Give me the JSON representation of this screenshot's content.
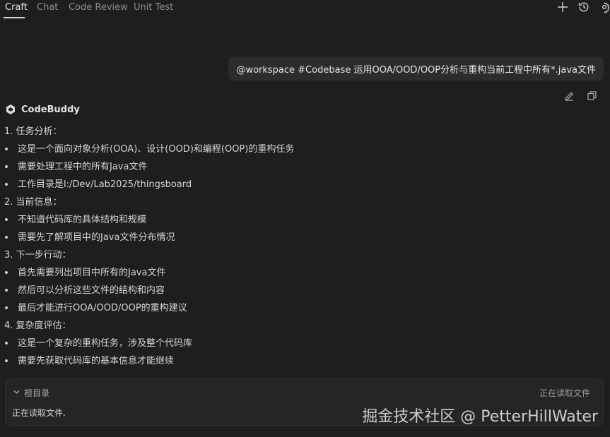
{
  "tabs": [
    {
      "label": "Craft",
      "active": true
    },
    {
      "label": "Chat",
      "active": false
    },
    {
      "label": "Code Review",
      "active": false
    },
    {
      "label": "Unit Test",
      "active": false
    }
  ],
  "toolbar_icons": [
    "plus-icon",
    "history-icon",
    "settings-icon"
  ],
  "user_message": "@workspace #Codebase 运用OOA/OOD/OOP分析与重构当前工程中所有*.java文件",
  "message_actions": [
    "edit-icon",
    "copy-icon"
  ],
  "assistant": {
    "name": "CodeBuddy",
    "lines": [
      {
        "type": "heading",
        "text": "1. 任务分析："
      },
      {
        "type": "bullet",
        "text": "这是一个面向对象分析(OOA)、设计(OOD)和编程(OOP)的重构任务"
      },
      {
        "type": "bullet",
        "text": "需要处理工程中的所有Java文件"
      },
      {
        "type": "bullet",
        "text": "工作目录是l:/Dev/Lab2025/thingsboard"
      },
      {
        "type": "heading",
        "text": "2. 当前信息："
      },
      {
        "type": "bullet",
        "text": "不知道代码库的具体结构和规模"
      },
      {
        "type": "bullet",
        "text": "需要先了解项目中的Java文件分布情况"
      },
      {
        "type": "heading",
        "text": "3. 下一步行动："
      },
      {
        "type": "bullet",
        "text": "首先需要列出项目中所有的Java文件"
      },
      {
        "type": "bullet",
        "text": "然后可以分析这些文件的结构和内容"
      },
      {
        "type": "bullet",
        "text": "最后才能进行OOA/OOD/OOP的重构建议"
      },
      {
        "type": "heading",
        "text": "4. 复杂度评估："
      },
      {
        "type": "bullet",
        "text": "这是一个复杂的重构任务，涉及整个代码库"
      },
      {
        "type": "bullet",
        "text": "需要先获取代码库的基本信息才能继续"
      }
    ]
  },
  "panel": {
    "title": "根目录",
    "status": "正在读取文件",
    "body": "正在读取文件."
  },
  "watermark": "掘金技术社区 @ PetterHillWater",
  "colors": {
    "background": "#1e1e1e",
    "bubble": "#2c2c2c",
    "panel": "#252526",
    "text": "#d6d6d6",
    "muted": "#8d8d8d"
  }
}
